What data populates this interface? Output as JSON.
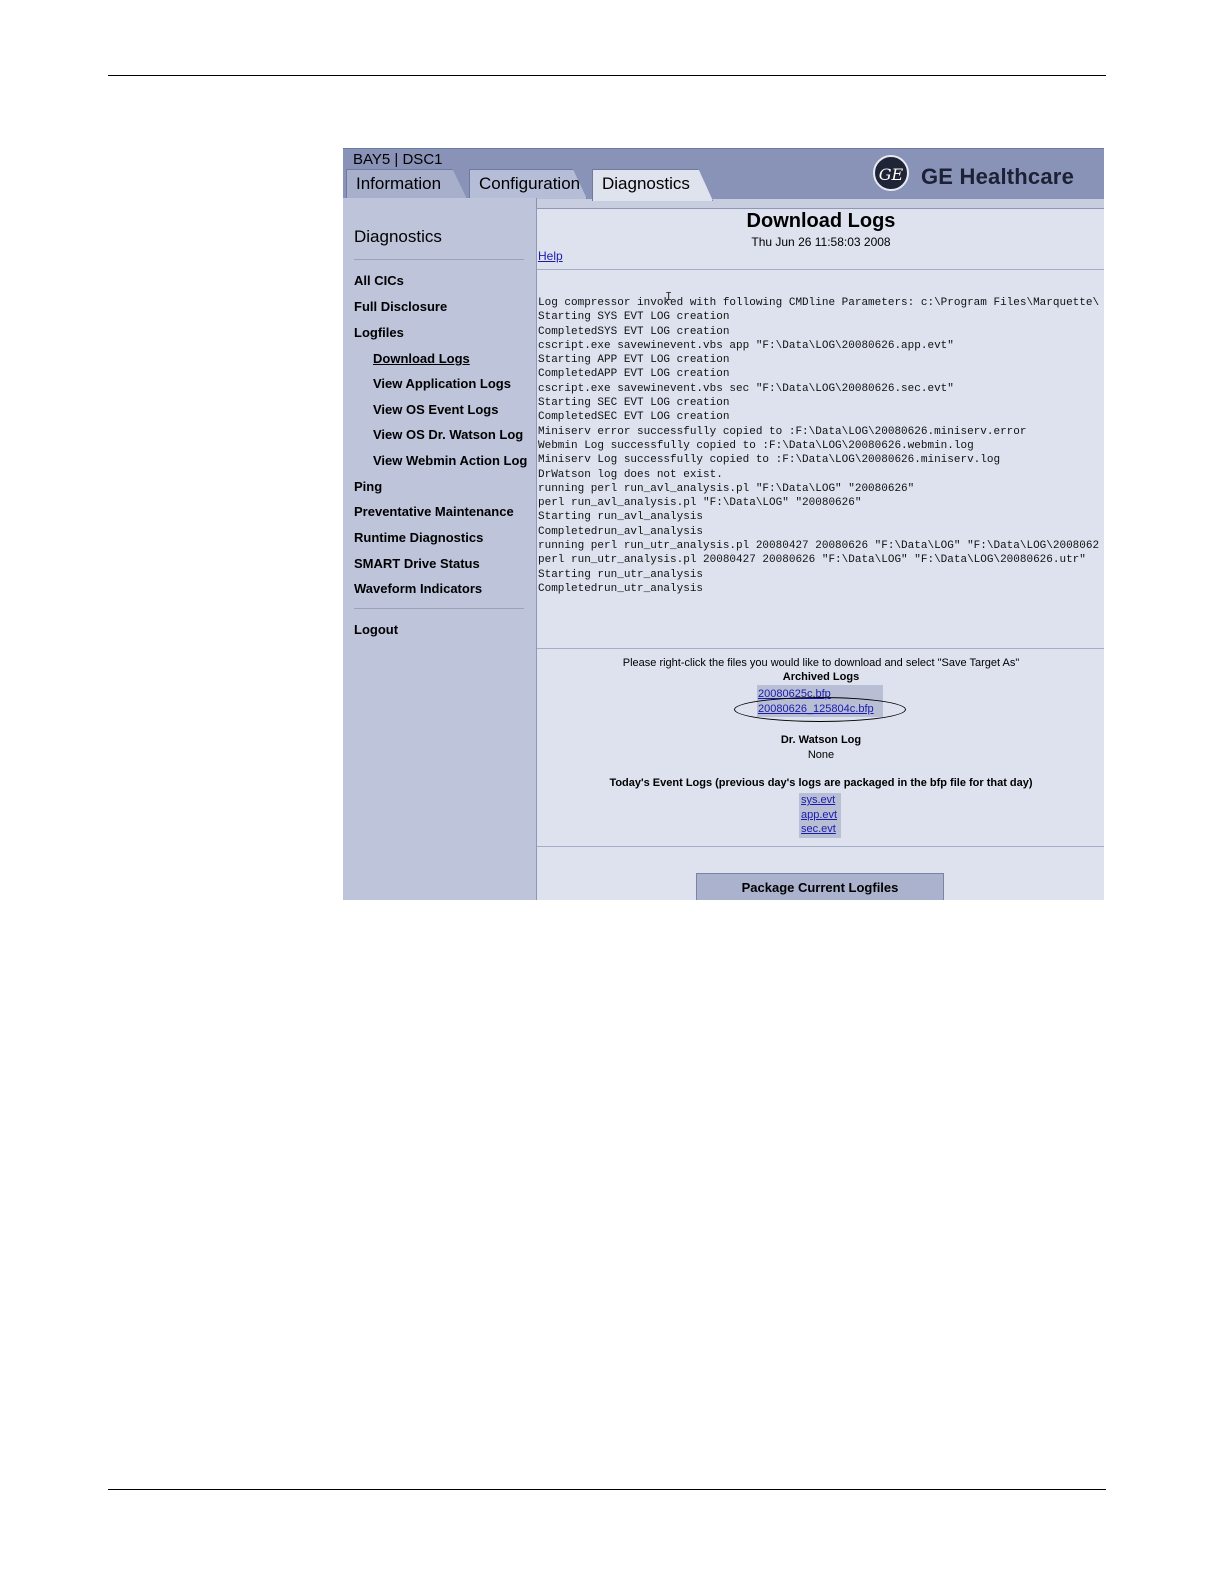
{
  "app": {
    "station": "BAY5 | DSC1",
    "tabs": [
      {
        "label": "Information"
      },
      {
        "label": "Configuration"
      },
      {
        "label": "Diagnostics"
      }
    ],
    "brand": {
      "logo_text": "GE",
      "name": "GE Healthcare",
      "logo_icon": "ge-monogram-icon"
    }
  },
  "sidebar": {
    "title": "Diagnostics",
    "items": [
      {
        "label": "All CICs"
      },
      {
        "label": "Full Disclosure"
      },
      {
        "label": "Logfiles"
      },
      {
        "label": "Download Logs"
      },
      {
        "label": "View Application Logs"
      },
      {
        "label": "View OS Event Logs"
      },
      {
        "label": "View OS Dr. Watson Log"
      },
      {
        "label": "View Webmin Action Log"
      },
      {
        "label": "Ping"
      },
      {
        "label": "Preventative Maintenance"
      },
      {
        "label": "Runtime Diagnostics"
      },
      {
        "label": "SMART Drive Status"
      },
      {
        "label": "Waveform Indicators"
      },
      {
        "label": "Logout"
      }
    ]
  },
  "main": {
    "title": "Download Logs",
    "date": "Thu Jun 26 11:58:03 2008",
    "help": "Help",
    "log_lines": [
      "Log compressor invoked with following CMDline Parameters: c:\\Program Files\\Marquette\\",
      "Starting SYS EVT LOG creation",
      "CompletedSYS EVT LOG creation",
      "cscript.exe savewinevent.vbs app \"F:\\Data\\LOG\\20080626.app.evt\"",
      "Starting APP EVT LOG creation",
      "CompletedAPP EVT LOG creation",
      "cscript.exe savewinevent.vbs sec \"F:\\Data\\LOG\\20080626.sec.evt\"",
      "Starting SEC EVT LOG creation",
      "CompletedSEC EVT LOG creation",
      "Miniserv error successfully copied to :F:\\Data\\LOG\\20080626.miniserv.error",
      "Webmin Log successfully copied to :F:\\Data\\LOG\\20080626.webmin.log",
      "Miniserv Log successfully copied to :F:\\Data\\LOG\\20080626.miniserv.log",
      "DrWatson log does not exist.",
      "running perl run_avl_analysis.pl \"F:\\Data\\LOG\" \"20080626\"",
      "perl run_avl_analysis.pl \"F:\\Data\\LOG\" \"20080626\"",
      "Starting run_avl_analysis",
      "Completedrun_avl_analysis",
      "running perl run_utr_analysis.pl 20080427 20080626 \"F:\\Data\\LOG\" \"F:\\Data\\LOG\\2008062",
      "perl run_utr_analysis.pl 20080427 20080626 \"F:\\Data\\LOG\" \"F:\\Data\\LOG\\20080626.utr\"",
      "Starting run_utr_analysis",
      "Completedrun_utr_analysis"
    ],
    "instructions": "Please right-click the files you would like to download and select \"Save Target As\"",
    "archived_title": "Archived Logs",
    "archived_files": [
      "20080625c.bfp",
      "20080626_125804c.bfp"
    ],
    "watson_title": "Dr. Watson Log",
    "watson_value": "None",
    "event_title": "Today's Event Logs (previous day's logs are packaged in the bfp file for that day)",
    "event_files": [
      "sys.evt",
      "app.evt",
      "sec.evt"
    ],
    "package_button": "Package Current Logfiles"
  }
}
